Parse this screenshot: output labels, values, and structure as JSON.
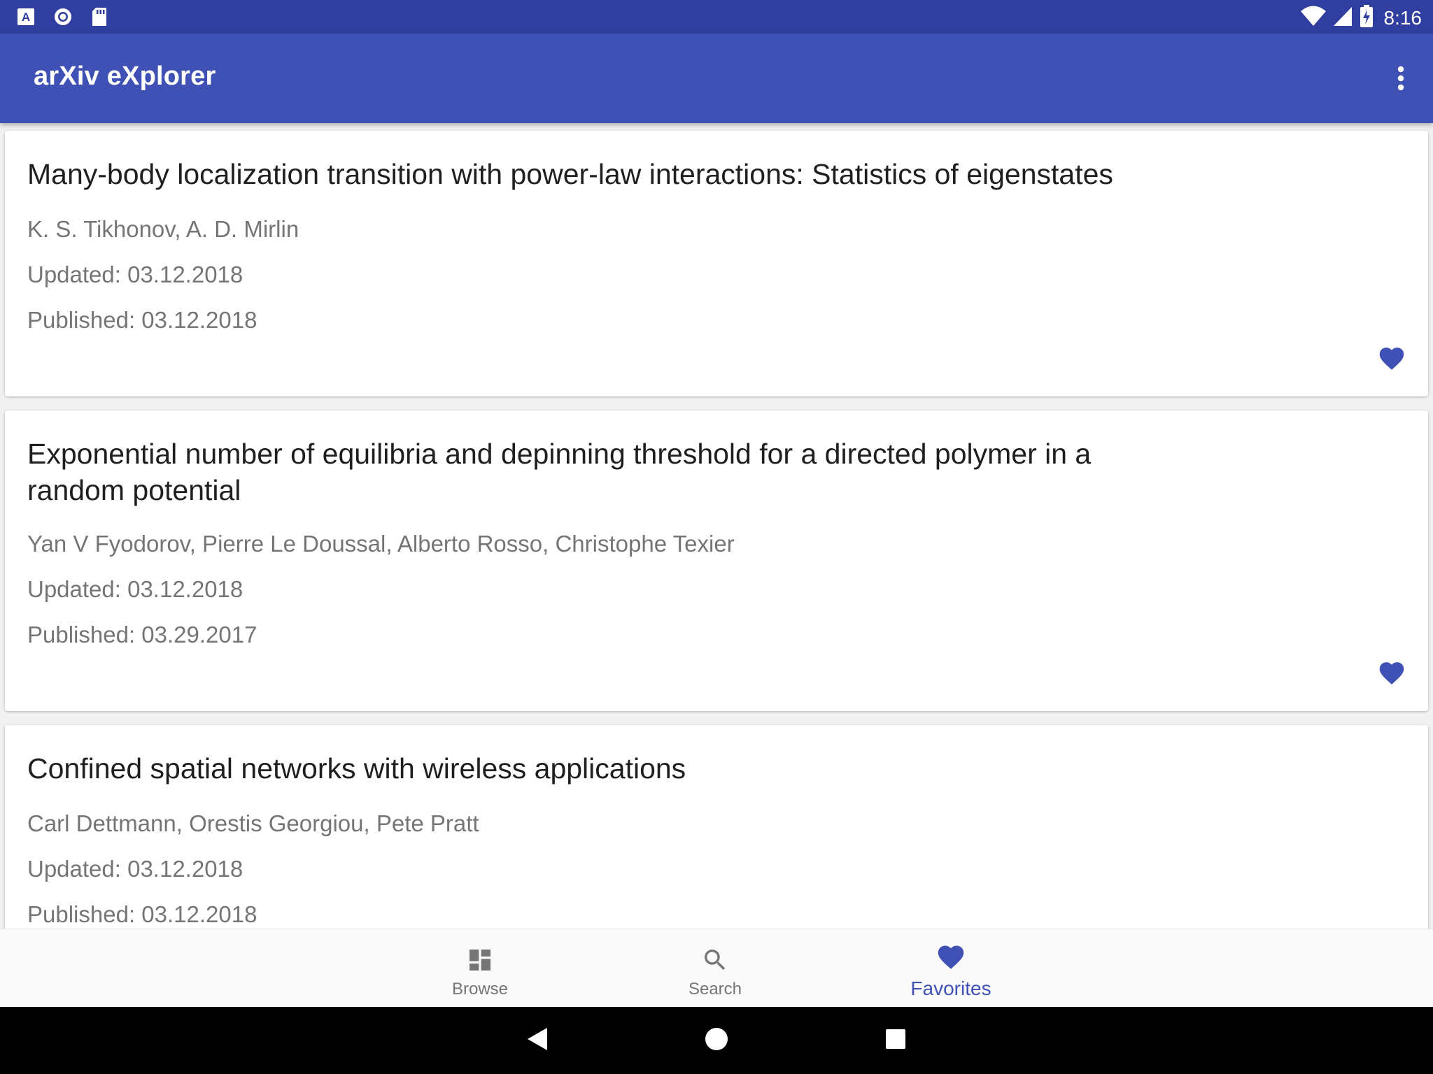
{
  "status_bar": {
    "time": "8:16",
    "left_icons": [
      "a-notification-icon",
      "circle-notification-icon",
      "sd-card-icon"
    ],
    "right_icons": [
      "wifi-icon",
      "signal-icon",
      "battery-charging-icon"
    ]
  },
  "app_bar": {
    "title": "arXiv eXplorer",
    "menu_icon": "more-vert-icon"
  },
  "colors": {
    "primary": "#3f51b5",
    "primary_dark": "#303f9f",
    "secondary_text": "#757575"
  },
  "papers": [
    {
      "title": "Many-body localization transition with power-law interactions: Statistics of eigenstates",
      "authors": "K. S. Tikhonov, A. D. Mirlin",
      "updated": "Updated: 03.12.2018",
      "published": "Published: 03.12.2018",
      "favorite": true
    },
    {
      "title": "Exponential number of equilibria and depinning threshold for a directed polymer in a random potential",
      "authors": "Yan V Fyodorov, Pierre Le Doussal, Alberto Rosso, Christophe Texier",
      "updated": "Updated: 03.12.2018",
      "published": "Published: 03.29.2017",
      "favorite": true
    },
    {
      "title": "Confined spatial networks with wireless applications",
      "authors": "Carl Dettmann, Orestis Georgiou, Pete Pratt",
      "updated": "Updated: 03.12.2018",
      "published": "Published: 03.12.2018",
      "favorite": true
    }
  ],
  "bottom_nav": {
    "items": [
      {
        "label": "Browse",
        "icon": "dashboard-icon",
        "active": false
      },
      {
        "label": "Search",
        "icon": "search-icon",
        "active": false
      },
      {
        "label": "Favorites",
        "icon": "heart-icon",
        "active": true
      }
    ]
  },
  "system_nav": {
    "back_icon": "back-icon",
    "home_icon": "home-icon",
    "recents_icon": "recents-icon"
  }
}
